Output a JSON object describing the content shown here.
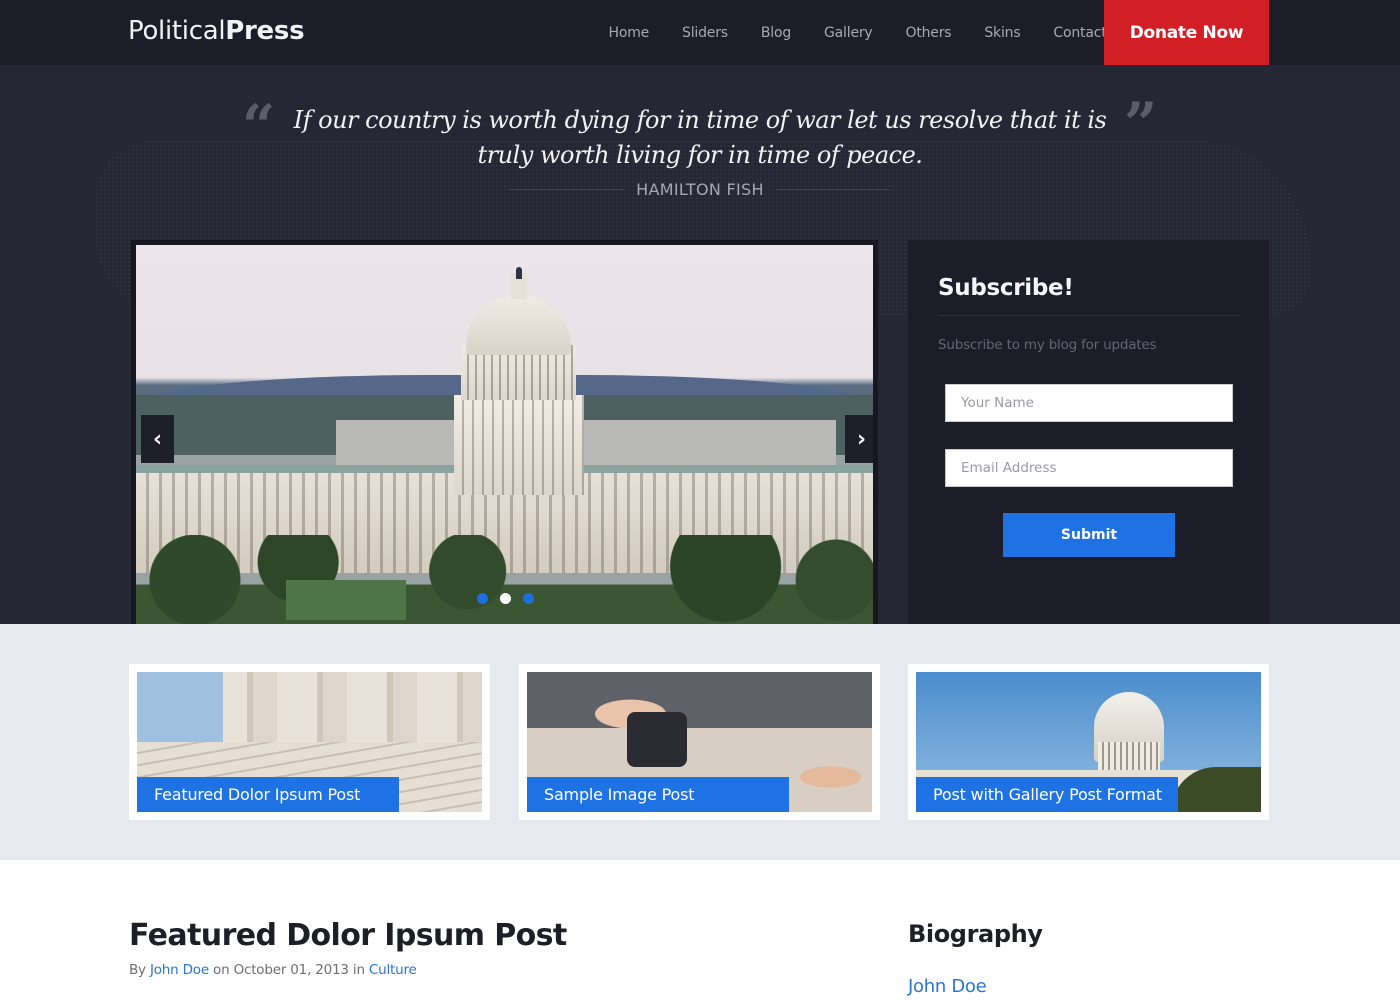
{
  "header": {
    "logo_light": "Political",
    "logo_bold": "Press",
    "nav": [
      {
        "label": "Home"
      },
      {
        "label": "Sliders"
      },
      {
        "label": "Blog"
      },
      {
        "label": "Gallery"
      },
      {
        "label": "Others"
      },
      {
        "label": "Skins"
      },
      {
        "label": "Contact"
      }
    ],
    "donate_label": "Donate Now"
  },
  "hero": {
    "quote_open": "“",
    "quote_close": "”",
    "quote": "If our country is worth dying for in time of war let us resolve that it is truly worth living for in time of peace.",
    "author": "HAMILTON FISH"
  },
  "slider": {
    "prev_icon": "‹",
    "next_icon": "›",
    "slide_count": 3,
    "active_slide": 2
  },
  "subscribe": {
    "title": "Subscribe!",
    "description": "Subscribe to my blog for updates",
    "name_placeholder": "Your Name",
    "email_placeholder": "Email Address",
    "submit_label": "Submit"
  },
  "featured": [
    {
      "label": "Featured Dolor Ipsum Post"
    },
    {
      "label": "Sample Image Post"
    },
    {
      "label": "Post with Gallery Post Format"
    }
  ],
  "post": {
    "title": "Featured Dolor Ipsum Post",
    "by": "By ",
    "author": "John Doe",
    "on": " on October 01, 2013 in ",
    "category": "Culture"
  },
  "biography": {
    "title": "Biography",
    "name": "John Doe"
  },
  "colors": {
    "header_bg": "#1c1d29",
    "hero_bg": "#252735",
    "donate": "#d21f26",
    "accent_blue": "#1f72e3",
    "strip_bg": "#e8e9ee"
  }
}
